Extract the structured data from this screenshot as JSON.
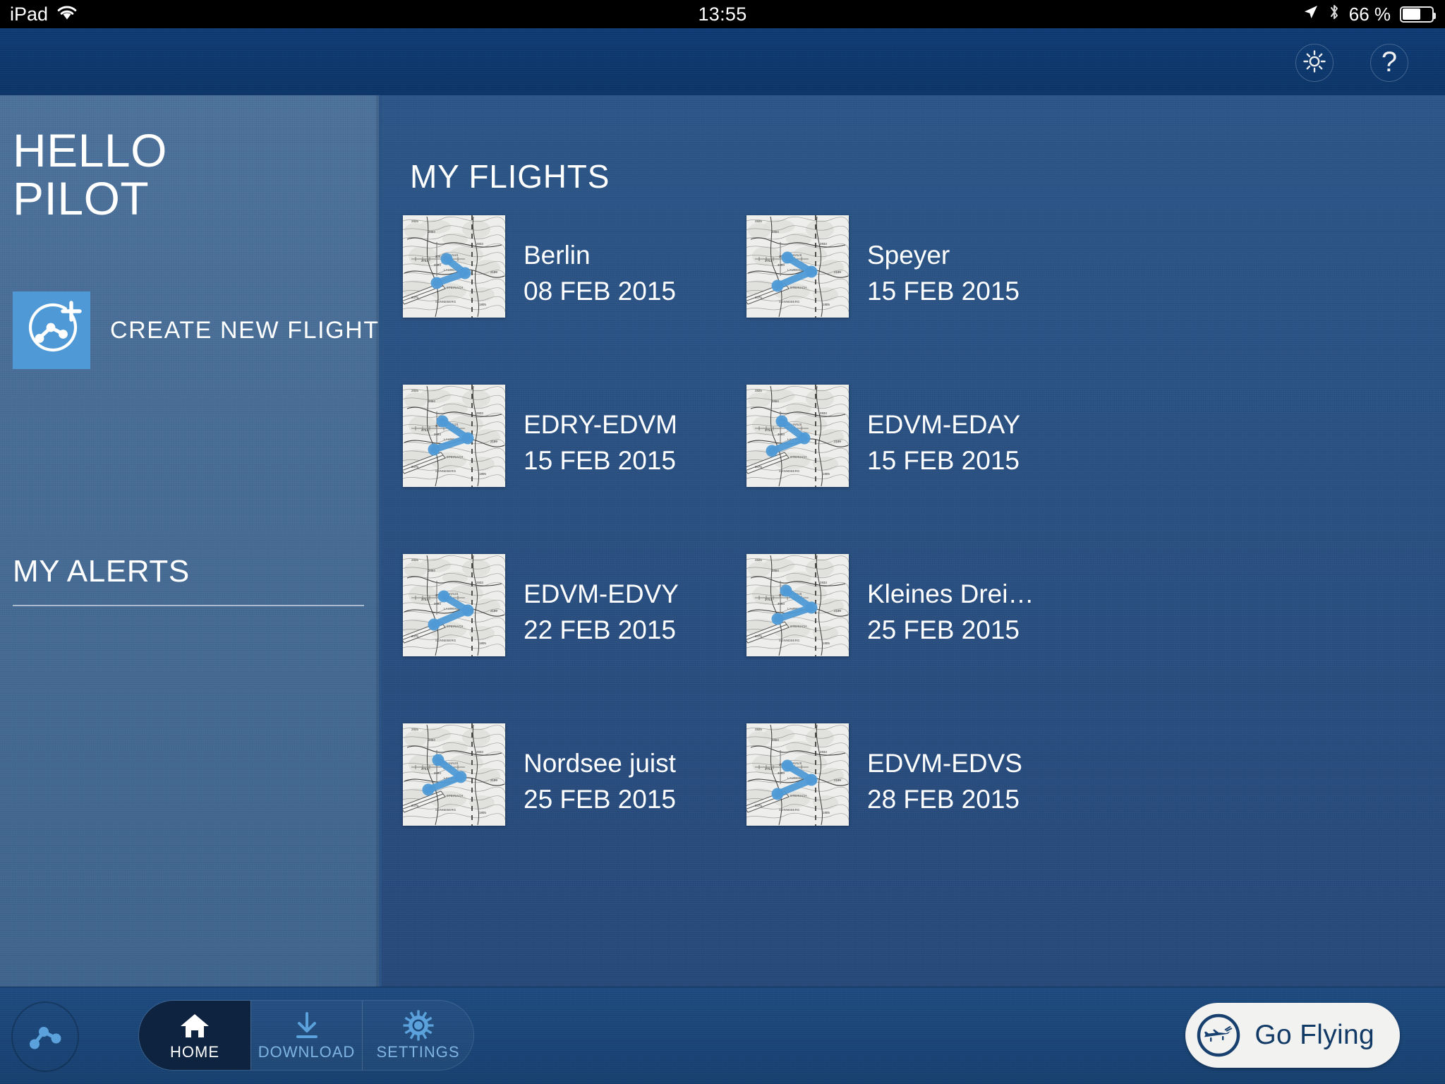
{
  "status_bar": {
    "device": "iPad",
    "wifi_icon": "wifi-icon",
    "time": "13:55",
    "location_icon": "location-arrow-icon",
    "bluetooth_icon": "bluetooth-icon",
    "battery_percent": "66 %",
    "battery_level": 66
  },
  "header": {
    "brightness_icon": "brightness-icon",
    "help_icon": "help-question-icon",
    "help_label": "?"
  },
  "sidebar": {
    "greeting_line1": "HELLO",
    "greeting_line2": "PILOT",
    "create_flight": {
      "label": "CREATE NEW FLIGHT",
      "icon": "route-plus-icon",
      "tile_color": "#4f9ad6"
    },
    "alerts_title": "MY ALERTS",
    "alerts_items": []
  },
  "main": {
    "title": "MY FLIGHTS",
    "flights": [
      {
        "name": "Berlin",
        "date": "08 FEB 2015",
        "thumbnail": "map-thumbnail",
        "route": 0
      },
      {
        "name": "Speyer",
        "date": "15 FEB 2015",
        "thumbnail": "map-thumbnail",
        "route": 1
      },
      {
        "name": "EDRY-EDVM",
        "date": "15 FEB 2015",
        "thumbnail": "map-thumbnail",
        "route": 2
      },
      {
        "name": "EDVM-EDAY",
        "date": "15 FEB 2015",
        "thumbnail": "map-thumbnail",
        "route": 3
      },
      {
        "name": "EDVM-EDVY",
        "date": "22 FEB 2015",
        "thumbnail": "map-thumbnail",
        "route": 1
      },
      {
        "name": "Kleines Drei…",
        "date": "25 FEB 2015",
        "thumbnail": "map-thumbnail",
        "route": 2
      },
      {
        "name": "Nordsee juist",
        "date": "25 FEB 2015",
        "thumbnail": "map-thumbnail",
        "route": 3
      },
      {
        "name": "EDVM-EDVS",
        "date": "28 FEB 2015",
        "thumbnail": "map-thumbnail",
        "route": 1
      }
    ]
  },
  "bottom_bar": {
    "route_badge_icon": "route-icon",
    "tabs": [
      {
        "label": "HOME",
        "icon": "home-icon",
        "active": true
      },
      {
        "label": "DOWNLOAD",
        "icon": "download-icon",
        "active": false
      },
      {
        "label": "SETTINGS",
        "icon": "gear-icon",
        "active": false
      }
    ],
    "go_flying": {
      "label": "Go Flying",
      "icon": "airplane-circle-icon"
    }
  },
  "colors": {
    "header_blue": "#0e3b74",
    "sidebar_blue": "#4c719a",
    "main_blue": "#2c5687",
    "accent_blue": "#4f9ad6",
    "bottom_blue": "#1d4a80",
    "active_tab": "#0d2340",
    "go_flying_bg": "#f2f2f0",
    "go_flying_text": "#123a66"
  }
}
